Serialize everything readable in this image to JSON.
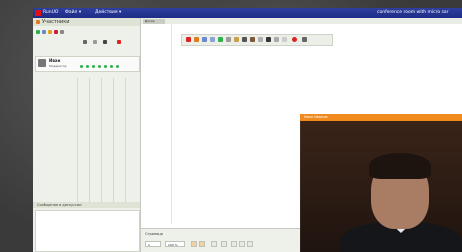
{
  "titlebar": {
    "app_name": "RunUO",
    "menu_file": "Файл ▾",
    "menu_view": "Действия ▾",
    "right_text": "conference room with micro sar"
  },
  "left_panel": {
    "title": "Участники",
    "user": {
      "name": "Иван",
      "status": "Модератор"
    },
    "chat_header": "Сообщения в дискуссии"
  },
  "workspace": {
    "tab_label": "Доска"
  },
  "bottom_bar": {
    "label": "Страница",
    "page_field": "1",
    "zoom_field": "100 %"
  },
  "video": {
    "window_title": "Иван Иванов"
  },
  "colors": {
    "titlebar": "#1d2c86",
    "accent_orange": "#f08a1c",
    "status_green": "#2db34a",
    "logo_red": "#dd1111"
  }
}
